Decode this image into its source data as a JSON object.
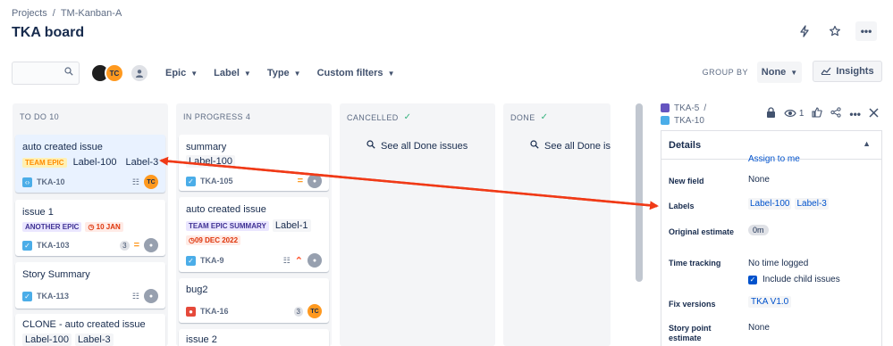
{
  "breadcrumb": {
    "projects": "Projects",
    "separator": "/",
    "project": "TM-Kanban-A"
  },
  "page_title": "TKA board",
  "toolbar": {
    "avatar_initials": "TC",
    "filters": [
      "Epic",
      "Label",
      "Type",
      "Custom filters"
    ],
    "group_by_label": "GROUP BY",
    "group_by_value": "None",
    "insights_label": "Insights"
  },
  "columns": {
    "todo": "TO DO 10",
    "inprogress": "IN PROGRESS 4",
    "cancelled": "CANCELLED",
    "done": "DONE",
    "see_all": "See all Done issues"
  },
  "todo_cards": [
    {
      "title": "auto created issue",
      "epic": "TEAM EPIC",
      "labels": [
        "Label-100",
        "Label-3"
      ],
      "key": "TKA-10",
      "assignee": "TC"
    },
    {
      "title": "issue 1",
      "epic": "ANOTHER EPIC",
      "date": "10 JAN",
      "key": "TKA-103",
      "count": "3"
    },
    {
      "title": "Story Summary",
      "key": "TKA-113"
    },
    {
      "title": "CLONE - auto created issue",
      "labels": [
        "Label-100",
        "Label-3"
      ]
    }
  ],
  "inprogress_cards": [
    {
      "title": "summary",
      "labels": [
        "Label-100"
      ],
      "key": "TKA-105"
    },
    {
      "title": "auto created issue",
      "epic": "TEAM EPIC SUMMARY",
      "labels": [
        "Label-1"
      ],
      "date": "09 DEC 2022",
      "key": "TKA-9"
    },
    {
      "title": "bug2",
      "key": "TKA-16",
      "count": "3",
      "assignee": "TC"
    },
    {
      "title": "issue 2"
    }
  ],
  "panel": {
    "parent_key": "TKA-5",
    "sep": "/",
    "issue_key": "TKA-10",
    "watch_count": "1",
    "details_heading": "Details",
    "assign_to_me": "Assign to me",
    "fields": {
      "new_field": {
        "name": "New field",
        "value": "None"
      },
      "labels": {
        "name": "Labels",
        "values": [
          "Label-100",
          "Label-3"
        ]
      },
      "original_estimate": {
        "name": "Original estimate",
        "value": "0m"
      },
      "time_tracking": {
        "name": "Time tracking",
        "value": "No time logged",
        "checkbox": "Include child issues"
      },
      "fix_versions": {
        "name": "Fix versions",
        "value": "TKA V1.0"
      },
      "story_point": {
        "name": "Story point estimate",
        "value": "None"
      }
    }
  },
  "colors": {
    "arrow": "#f03a17",
    "accent": "#0052cc",
    "column_bg": "#f4f5f7"
  }
}
